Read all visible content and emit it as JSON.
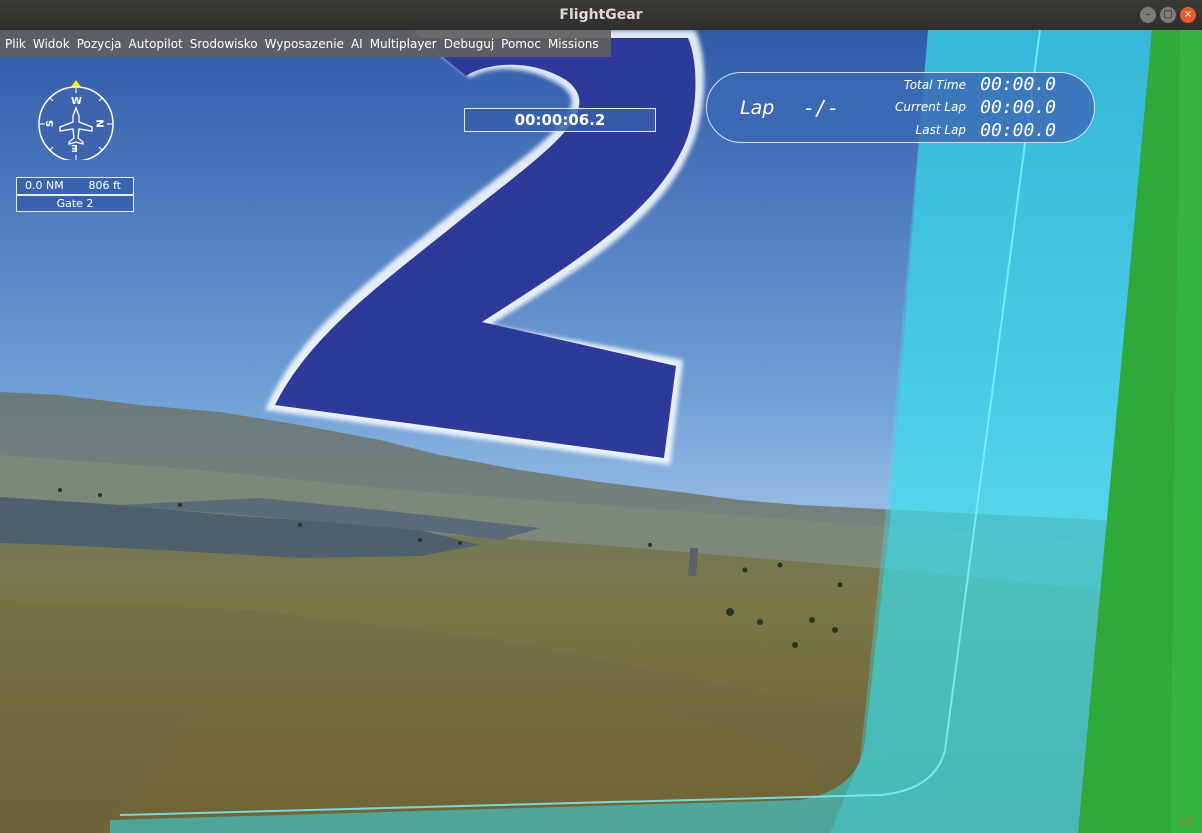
{
  "window": {
    "title": "FlightGear"
  },
  "menu": [
    "Plik",
    "Widok",
    "Pozycja",
    "Autopilot",
    "Srodowisko",
    "Wyposazenie",
    "AI",
    "Multiplayer",
    "Debuguj",
    "Pomoc",
    "Missions"
  ],
  "compass": {
    "n": "N",
    "e": "E",
    "s": "S",
    "w": "W"
  },
  "nav": {
    "distance": "0.0 NM",
    "altitude": "806 ft",
    "gate": "Gate 2"
  },
  "timer": "00:00:06.2",
  "gate_number": "2",
  "lap": {
    "label": "Lap",
    "count": "-/-",
    "total_time_label": "Total Time",
    "total_time": "00:00.0",
    "current_lap_label": "Current Lap",
    "current_lap": "00:00.0",
    "last_lap_label": "Last Lap",
    "last_lap": "00:00.0"
  },
  "fps": "17",
  "colors": {
    "hud_blue": "#3a64ac",
    "gate_blue": "#2e3a9a",
    "cyan": "#38e0ee",
    "green": "#2ea83c"
  }
}
